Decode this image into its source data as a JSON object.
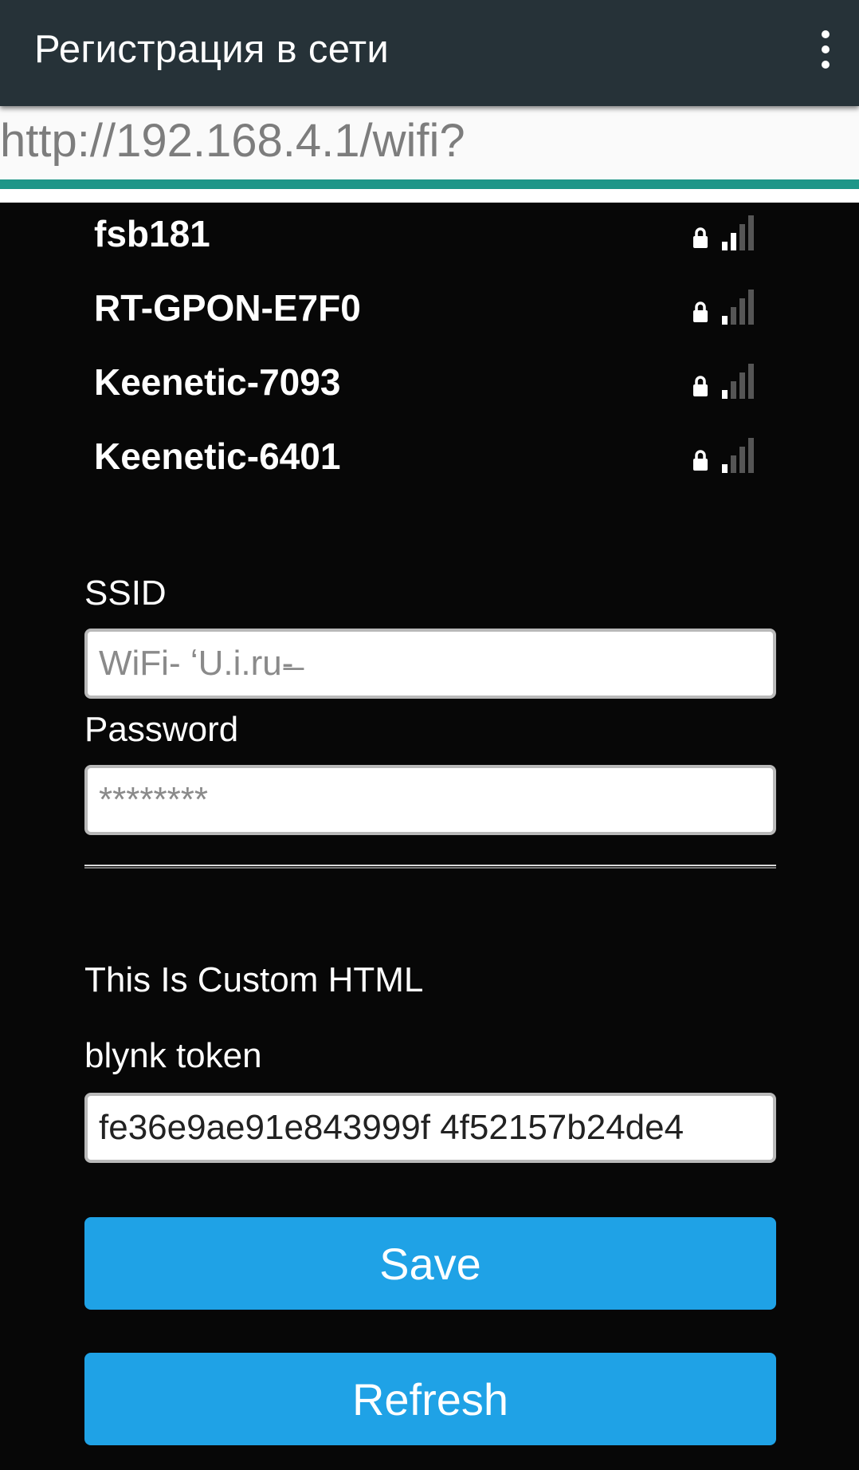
{
  "appbar": {
    "title": "Регистрация в сети",
    "menu_icon": "more-vert-icon"
  },
  "urlbar": {
    "url": "http://192.168.4.1/wifi?",
    "progress_percent": 100
  },
  "networks": [
    {
      "ssid": "fsb181",
      "secured": true,
      "signal_bars": 2
    },
    {
      "ssid": "RT-GPON-E7F0",
      "secured": true,
      "signal_bars": 1
    },
    {
      "ssid": "Keenetic-7093",
      "secured": true,
      "signal_bars": 1
    },
    {
      "ssid": "Keenetic-6401",
      "secured": true,
      "signal_bars": 1
    }
  ],
  "form": {
    "ssid_label": "SSID",
    "ssid_placeholder": "WiFi- ʻU.i.ru-̶̶̶",
    "password_label": "Password",
    "password_placeholder": "********",
    "custom_html_text": "This Is Custom HTML",
    "token_label": "blynk token",
    "token_value": "fe36e9ae91e843999f 4f52157b24de4",
    "save_label": "Save",
    "refresh_label": "Refresh"
  },
  "colors": {
    "appbar": "#263238",
    "progress": "#1e9688",
    "button": "#1fa2e6",
    "background": "#070707"
  }
}
